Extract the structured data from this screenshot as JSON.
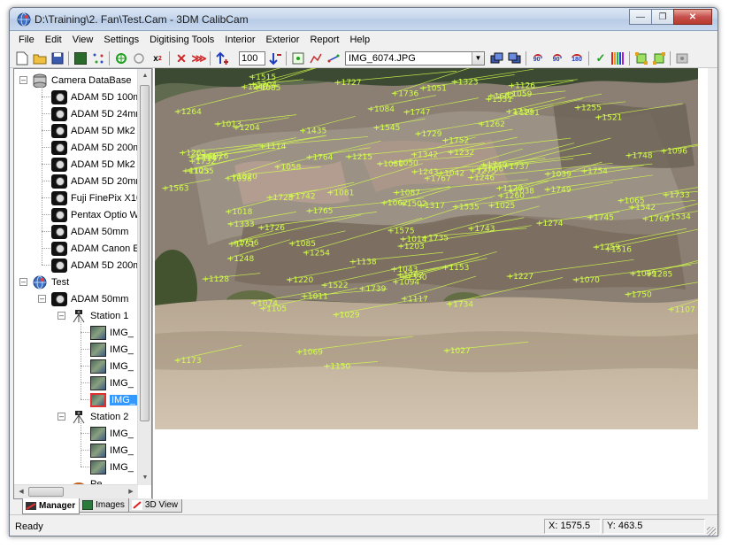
{
  "window": {
    "title": "D:\\Training\\2. Fan\\Test.Cam - 3DM CalibCam",
    "controls": [
      "minimize",
      "maximize",
      "close"
    ]
  },
  "menu": [
    "File",
    "Edit",
    "View",
    "Settings",
    "Digitising Tools",
    "Interior",
    "Exterior",
    "Report",
    "Help"
  ],
  "toolbar": {
    "zoom_value": "100",
    "image_select": "IMG_6074.JPG",
    "rotate_90_left": "90°",
    "rotate_90_right": "90°",
    "rotate_180": "180"
  },
  "tree": {
    "camera_database": {
      "label": "Camera DataBase",
      "items": [
        "ADAM 5D 100mm",
        "ADAM 5D 24mm",
        "ADAM 5D Mk2",
        "ADAM 5D 200mm",
        "ADAM 5D Mk2",
        "ADAM 5D 20mm",
        "Fuji FinePix X10",
        "Pentax Optio W",
        "ADAM 50mm",
        "ADAM Canon E",
        "ADAM 5D 200mm"
      ]
    },
    "project": {
      "label": "Test",
      "camera": "ADAM 50mm",
      "stations": [
        {
          "label": "Station 1",
          "images": [
            "IMG_",
            "IMG_",
            "IMG_",
            "IMG_",
            "IMG_"
          ],
          "selected_index": 4
        },
        {
          "label": "Station 2",
          "images": [
            "IMG_",
            "IMG_",
            "IMG_"
          ]
        }
      ],
      "partial_item": "Pe..."
    }
  },
  "tabs": [
    {
      "label": "Manager",
      "active": true,
      "icon": "manager-icon"
    },
    {
      "label": "Images",
      "active": false,
      "icon": "images-icon"
    },
    {
      "label": "3D View",
      "active": false,
      "icon": "3d-view-icon"
    }
  ],
  "point_labels": [
    "+1317",
    "+1087",
    "+1275",
    "+1059",
    "+1291",
    "+1085",
    "+1098",
    "+1062",
    "+1074",
    "+1232",
    "+1215",
    "+1220",
    "+1066",
    "+1204",
    "+1055",
    "+1096",
    "+1043",
    "+1435",
    "+1254",
    "+1285",
    "+1323",
    "+1058",
    "+1011",
    "+1246",
    "+1330",
    "+1248",
    "+1264",
    "+1227",
    "+1304",
    "+1153",
    "+1051",
    "+1147",
    "+1255",
    "+1662",
    "+1243",
    "+1203",
    "+1274",
    "+1128",
    "+1114",
    "+1050",
    "+1042",
    "+1038",
    "+1117",
    "+1735",
    "+1734",
    "+1736",
    "+1737",
    "+1767",
    "+1732",
    "+1730",
    "+1728",
    "+1733",
    "+1726",
    "+1522",
    "+1521",
    "+1542",
    "+1729",
    "+1727",
    "+1502",
    "+1545",
    "+1751",
    "+1752",
    "+1749",
    "+1750",
    "+1754",
    "+1756",
    "+1764",
    "+1760",
    "+1765",
    "+1534",
    "+1535",
    "+1759",
    "+1740",
    "+1739",
    "+1762",
    "+1748",
    "+1744",
    "+1745",
    "+1747",
    "+1742",
    "+1743",
    "+1563",
    "+1531",
    "+1575",
    "+1515",
    "+1516",
    "+1123",
    "+1120",
    "+1262",
    "+1265",
    "+1026",
    "+1027",
    "+1013",
    "+1020",
    "+1029",
    "+1099",
    "+1342",
    "+1025",
    "+1333",
    "+1070",
    "+1018",
    "+1050",
    "+1039",
    "+1014",
    "+1094",
    "+1107",
    "+1081",
    "+1065",
    "+1105",
    "+1138",
    "+1084",
    "+1173",
    "+1069",
    "+1260",
    "+1240",
    "+1126",
    "+1150",
    "+1085"
  ],
  "status": {
    "text": "Ready",
    "x": "X: 1575.5",
    "y": "Y: 463.5"
  },
  "colors": {
    "label_color": "#d4ff4a",
    "selection": "#3399ff"
  }
}
